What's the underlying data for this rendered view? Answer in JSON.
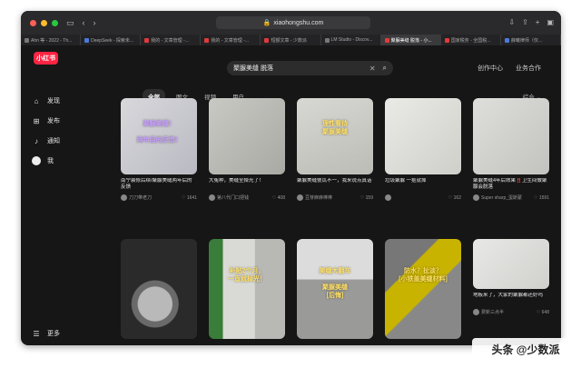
{
  "browser": {
    "url": "xiaohongshu.com",
    "tabs": [
      {
        "label": "Ahn 等 - 2022 - Th...",
        "fav": "gray"
      },
      {
        "label": "DeepSeek - 探索未...",
        "fav": "blue"
      },
      {
        "label": "我的 - 文章管理 -...",
        "fav": "red"
      },
      {
        "label": "我的 - 文章管理 -...",
        "fav": "red"
      },
      {
        "label": "短额文章 - 少数派",
        "fav": "red"
      },
      {
        "label": "LM Studio - Discov...",
        "fav": "gray"
      },
      {
        "label": "聚脲美缝 脱落 - 小...",
        "fav": "red",
        "active": true
      },
      {
        "label": "国家税务 - 全国税...",
        "fav": "red"
      },
      {
        "label": "薛曦律师（仅...",
        "fav": "blue"
      }
    ]
  },
  "app": {
    "logo": "小红书",
    "search_query": "聚脲美缝 脱落",
    "header_links": [
      "创作中心",
      "业务合作"
    ]
  },
  "sidebar": {
    "items": [
      {
        "label": "发现",
        "icon": "home-icon",
        "glyph": "⌂"
      },
      {
        "label": "发布",
        "icon": "plus-icon",
        "glyph": "⊞"
      },
      {
        "label": "通知",
        "icon": "bell-icon",
        "glyph": "♪"
      },
      {
        "label": "我",
        "icon": "avatar-icon",
        "glyph": ""
      }
    ],
    "more_label": "更多"
  },
  "filters": [
    "全部",
    "图文",
    "视频",
    "用户"
  ],
  "sort_label": "综合 ⌄",
  "cards": [
    {
      "title": "南宁装修后续/聚脲美缝两年后的反馈",
      "author": "刀刀带老刀",
      "likes": "1641",
      "overlay": "聚脲美缝！\n\n两年后的反馈！",
      "overlay_color": "#c9a0ff"
    },
    {
      "title": "大冤种，美缝全掉光了！",
      "author": "第八代门口把钱",
      "likes": "408",
      "overlay": "",
      "overlay_color": ""
    },
    {
      "title": "聚脲美缝傻瓜不一，我来说点真话",
      "author": "豆芽麻麻棒棒",
      "likes": "159",
      "overlay": "理性看待\n聚脲美缝",
      "overlay_color": "#ffe066"
    },
    {
      "title": "垃圾聚脲 一抠就掉",
      "author": "",
      "likes": "162",
      "overlay": "",
      "overlay_color": ""
    },
    {
      "title": "聚脲美缝4年后效果‼️卫生间做聚脲会脱落",
      "author": "Super sharp_蛋斯蒙",
      "likes": "1591",
      "overlay": "",
      "overlay_color": ""
    },
    {
      "title": "",
      "author": "",
      "likes": "",
      "overlay": "",
      "overlay_color": ""
    },
    {
      "title": "",
      "author": "",
      "likes": "",
      "overlay": "补贴2个月，\n一直就掉光！",
      "overlay_color": "#ffe066"
    },
    {
      "title": "",
      "author": "",
      "likes": "",
      "overlay": "美缝大翻车\n\n聚脲美缝\n[后悔]",
      "overlay_color": "#ffe066"
    },
    {
      "title": "",
      "author": "",
      "likes": "",
      "overlay": "防水？扯淡？\n[小铁盖美缝材料]",
      "overlay_color": "#ffe066"
    },
    {
      "title": "地板来了，大家的聚脲都还好吗",
      "author": "费新三点半",
      "likes": "648",
      "overlay": "",
      "overlay_color": ""
    }
  ],
  "watermark": "头条 @少数派"
}
